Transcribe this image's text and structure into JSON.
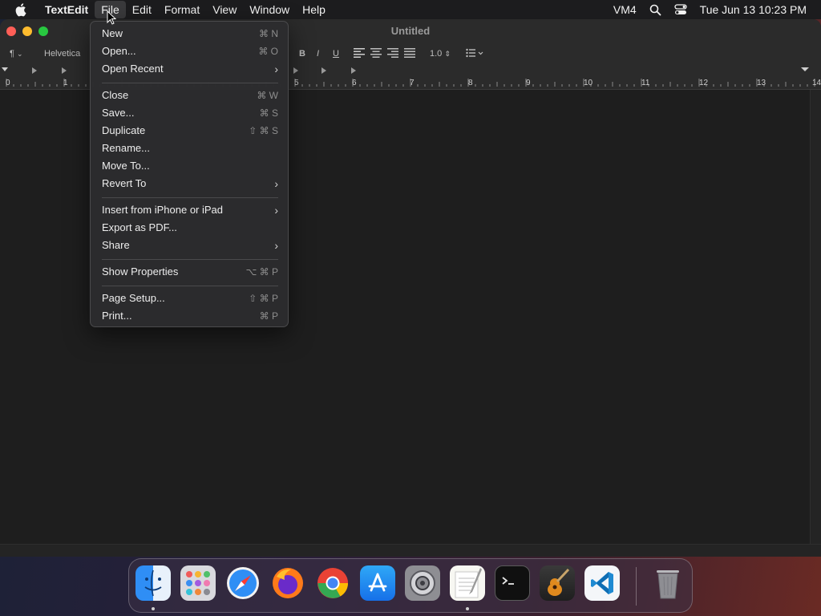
{
  "menubar": {
    "app_name": "TextEdit",
    "items": [
      "File",
      "Edit",
      "Format",
      "View",
      "Window",
      "Help"
    ],
    "active_item": "File",
    "status_label": "VM4",
    "clock": "Tue Jun 13  10:23 PM"
  },
  "window": {
    "title": "Untitled",
    "toolbar": {
      "paragraph_style": "¶",
      "font_family": "Helvetica",
      "bold": "B",
      "italic": "I",
      "underline": "U",
      "line_spacing": "1.0"
    },
    "ruler_numbers": [
      "0",
      "1",
      "5",
      "6",
      "7",
      "8",
      "9",
      "10",
      "11",
      "12",
      "13",
      "14"
    ]
  },
  "file_menu": {
    "groups": [
      [
        {
          "label": "New",
          "shortcut": "⌘ N",
          "submenu": false
        },
        {
          "label": "Open...",
          "shortcut": "⌘ O",
          "submenu": false
        },
        {
          "label": "Open Recent",
          "shortcut": "",
          "submenu": true
        }
      ],
      [
        {
          "label": "Close",
          "shortcut": "⌘ W",
          "submenu": false
        },
        {
          "label": "Save...",
          "shortcut": "⌘ S",
          "submenu": false
        },
        {
          "label": "Duplicate",
          "shortcut": "⇧ ⌘ S",
          "submenu": false
        },
        {
          "label": "Rename...",
          "shortcut": "",
          "submenu": false
        },
        {
          "label": "Move To...",
          "shortcut": "",
          "submenu": false
        },
        {
          "label": "Revert To",
          "shortcut": "",
          "submenu": true
        }
      ],
      [
        {
          "label": "Insert from iPhone or iPad",
          "shortcut": "",
          "submenu": true
        },
        {
          "label": "Export as PDF...",
          "shortcut": "",
          "submenu": false
        },
        {
          "label": "Share",
          "shortcut": "",
          "submenu": true
        }
      ],
      [
        {
          "label": "Show Properties",
          "shortcut": "⌥ ⌘ P",
          "submenu": false
        }
      ],
      [
        {
          "label": "Page Setup...",
          "shortcut": "⇧ ⌘ P",
          "submenu": false
        },
        {
          "label": "Print...",
          "shortcut": "⌘ P",
          "submenu": false
        }
      ]
    ]
  },
  "dock": {
    "apps": [
      {
        "name": "finder-icon",
        "running": true
      },
      {
        "name": "launchpad-icon",
        "running": false
      },
      {
        "name": "safari-icon",
        "running": false
      },
      {
        "name": "firefox-icon",
        "running": false
      },
      {
        "name": "chrome-icon",
        "running": false
      },
      {
        "name": "app-store-icon",
        "running": false
      },
      {
        "name": "system-settings-icon",
        "running": false
      },
      {
        "name": "textedit-icon",
        "running": true
      },
      {
        "name": "terminal-icon",
        "running": false
      },
      {
        "name": "garageband-icon",
        "running": false
      },
      {
        "name": "vscode-icon",
        "running": false
      },
      {
        "name": "trash-icon",
        "running": false
      }
    ]
  },
  "colors": {
    "menubar_bg": "#1c1c1e",
    "window_bg": "#1e1e1e",
    "menu_bg": "#2c2c2e",
    "close": "#ff5f57",
    "minimize": "#febc2e",
    "maximize": "#28c840"
  }
}
